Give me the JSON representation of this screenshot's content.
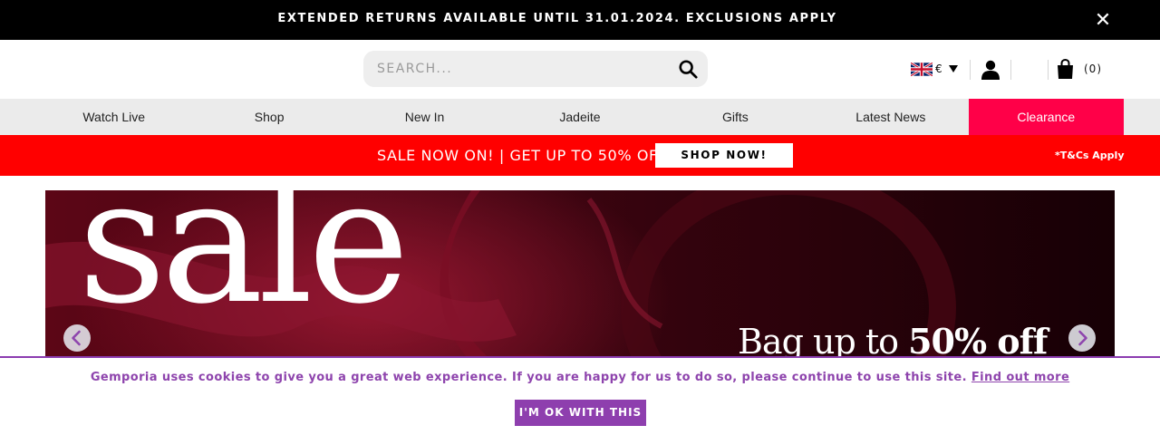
{
  "announcement": {
    "text": "EXTENDED RETURNS AVAILABLE UNTIL 31.01.2024. EXCLUSIONS APPLY",
    "close_icon": "close-icon"
  },
  "header": {
    "search": {
      "placeholder": "SEARCH...",
      "value": "",
      "icon": "search-icon"
    },
    "locale": {
      "flag": "uk-flag-icon",
      "currency": "€",
      "caret": "caret-down-icon"
    },
    "account_icon": "user-icon",
    "bag": {
      "icon": "shopping-bag-icon",
      "count": "(0)"
    }
  },
  "nav": {
    "items": [
      {
        "label": "Watch Live"
      },
      {
        "label": "Shop"
      },
      {
        "label": "New In"
      },
      {
        "label": "Jadeite"
      },
      {
        "label": "Gifts"
      },
      {
        "label": "Latest News"
      },
      {
        "label": "Clearance"
      }
    ],
    "active_index": 6,
    "active_color": "#ff0048"
  },
  "promo": {
    "text": "SALE NOW ON! | GET UP TO 50% OFF",
    "button": "SHOP NOW!",
    "terms": "*T&Cs Apply",
    "background": "#ff0000"
  },
  "hero": {
    "headline": "sale",
    "tagline_start": "Bag up to ",
    "tagline_bold": "50% off",
    "prev_icon": "chevron-left-icon",
    "next_icon": "chevron-right-icon"
  },
  "cookie": {
    "text": "Gemporia uses cookies to give you a great web experience. If you are happy for us to do so, please continue to use this site.",
    "link": "Find out more",
    "button": "I'M OK WITH THIS",
    "accent": "#8e44ad"
  }
}
